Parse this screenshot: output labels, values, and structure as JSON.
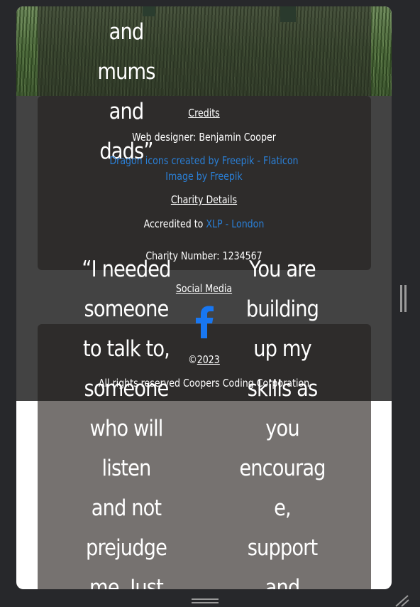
{
  "reviews": {
    "top_quote_lines": [
      "and",
      "mums",
      "and",
      "dads”"
    ],
    "left_quote_lines": [
      "“I needed",
      "someone",
      "to talk to,",
      "someone",
      "who will",
      "listen",
      "and not",
      "prejudge",
      "me. Just"
    ],
    "right_quote_lines": [
      "You are",
      "building",
      "up my",
      "skills as",
      "you",
      "encourag",
      "e,",
      "support",
      "and"
    ]
  },
  "footer": {
    "credits_heading": "Credits",
    "web_designer": "Web designer: Benjamin Cooper",
    "icons_credit_link": "Dragon icons created by Freepik - Flaticon",
    "image_credit_link": "Image by Freepik",
    "charity_heading": "Charity Details",
    "accredited_prefix": "Accredited to",
    "accredited_link": "XLP - London",
    "charity_number": "Charity Number: 1234567",
    "social_heading": "Social Media",
    "social_icons": [
      "facebook-icon"
    ],
    "copyright_symbol": "©",
    "copyright_year": "2023",
    "rights": "All rights reserved Coopers Coding Corporation"
  },
  "colors": {
    "page_background": "#27282b",
    "footer_background": "#434343",
    "card_background": "#2e2c2b",
    "lower_band": "#767270",
    "link": "#2a7fd6",
    "facebook_blue": "#1877f2"
  }
}
